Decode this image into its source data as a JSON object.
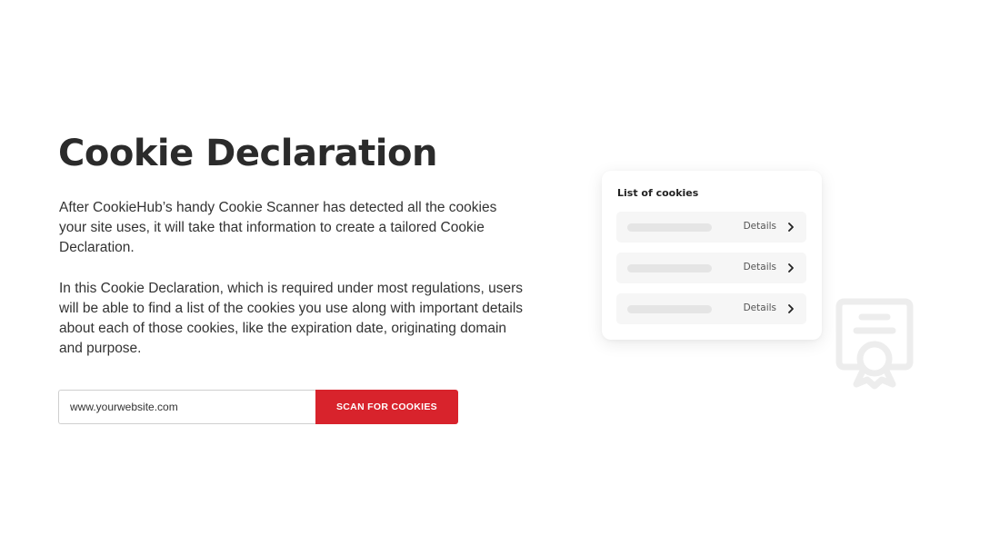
{
  "hero": {
    "title": "Cookie Declaration",
    "paragraph1": "After CookieHub’s handy Cookie Scanner has detected all the cookies your site uses, it will take that information to create a tailored Cookie Declaration.",
    "paragraph2": "In this Cookie Declaration, which is required under most regulations, users will be able to find a list of the cookies you use along with important details about each of those cookies, like the expiration date, originating domain and purpose."
  },
  "scan": {
    "input_value": "www.yourwebsite.com",
    "button_label": "SCAN FOR COOKIES"
  },
  "cookie_list": {
    "title": "List of cookies",
    "items": [
      {
        "details_label": "Details"
      },
      {
        "details_label": "Details"
      },
      {
        "details_label": "Details"
      }
    ]
  },
  "icons": {
    "row_chevron": "chevron-right-icon",
    "background": "certificate-icon"
  },
  "colors": {
    "accent": "#d8232c",
    "heading": "#2b2b2b",
    "body_text": "#333333",
    "icon_faint": "#ededed"
  }
}
